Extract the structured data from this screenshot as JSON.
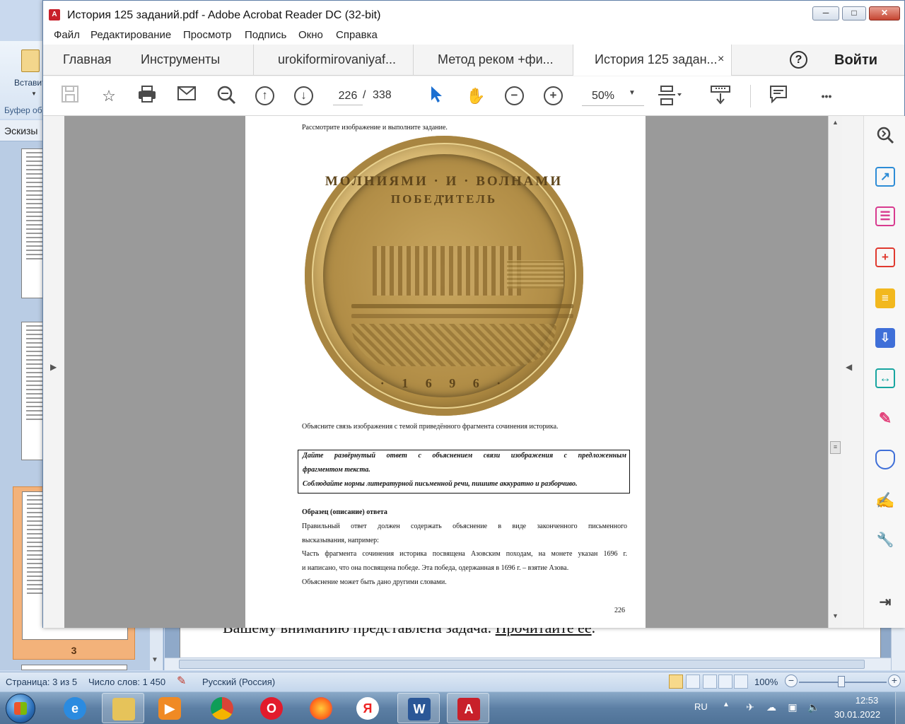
{
  "word": {
    "ribbon": {
      "paste_label": "Вставить",
      "clipboard_label": "Буфер об"
    },
    "thumbnails": {
      "header": "Эскизы",
      "page3_number": "3"
    },
    "document_text": {
      "part1": "Вашему вниманию представлена задача. ",
      "part2": "Прочитайте её",
      "part3": "."
    },
    "status": {
      "page": "Страница: 3 из 5",
      "words": "Число слов: 1 450",
      "language": "Русский (Россия)",
      "zoom": "100%"
    }
  },
  "acrobat": {
    "title": "История 125 заданий.pdf - Adobe Acrobat Reader DC (32-bit)",
    "window_buttons": {
      "minimize": "─",
      "maximize": "□",
      "close": "✕"
    },
    "menu": [
      "Файл",
      "Редактирование",
      "Просмотр",
      "Подпись",
      "Окно",
      "Справка"
    ],
    "tabs": {
      "home": "Главная",
      "tools": "Инструменты",
      "doc1": "urokiformirovaniyaf...",
      "doc2": "Метод реком +фи...",
      "doc3": "История 125 задан...",
      "close_glyph": "×"
    },
    "help_glyph": "?",
    "signin": "Войти",
    "toolbar": {
      "page_current": "226",
      "page_separator": "/",
      "page_total": "338",
      "zoom": "50%",
      "more_glyph": "•••"
    },
    "page": {
      "instruction": "Рассмотрите изображение и выполните задание.",
      "coin_legend_top": "МОЛНИЯМИ · И · ВОЛНАМИ ·",
      "coin_legend_bottom": "ПОБЕДИТЕЛЬ",
      "coin_year": "· 1 6 9 6 ·",
      "question": "Объясните связь изображения с темой приведённого фрагмента сочинения историка.",
      "task_box": [
        "Дайте развёрнутый ответ с объяснением связи изображения с предложенным",
        "фрагментом текста.",
        "Соблюдайте нормы литературной письменной речи, пишите аккуратно и разборчиво."
      ],
      "sample_heading": "Образец (описание) ответа",
      "sample_lines": [
        "Правильный ответ должен содержать объяснение в виде законченного письменного",
        "высказывания, например:",
        "Часть фрагмента сочинения историка посвящена Азовским походам, на монете указан 1696 г.",
        "и написано, что она посвящена победе. Эта победа, одержанная в 1696 г. – взятие Азова.",
        "Объяснение может быть дано другими словами."
      ],
      "page_number": "226"
    }
  },
  "taskbar": {
    "lang": "RU",
    "time": "12:53",
    "date": "30.01.2022"
  }
}
